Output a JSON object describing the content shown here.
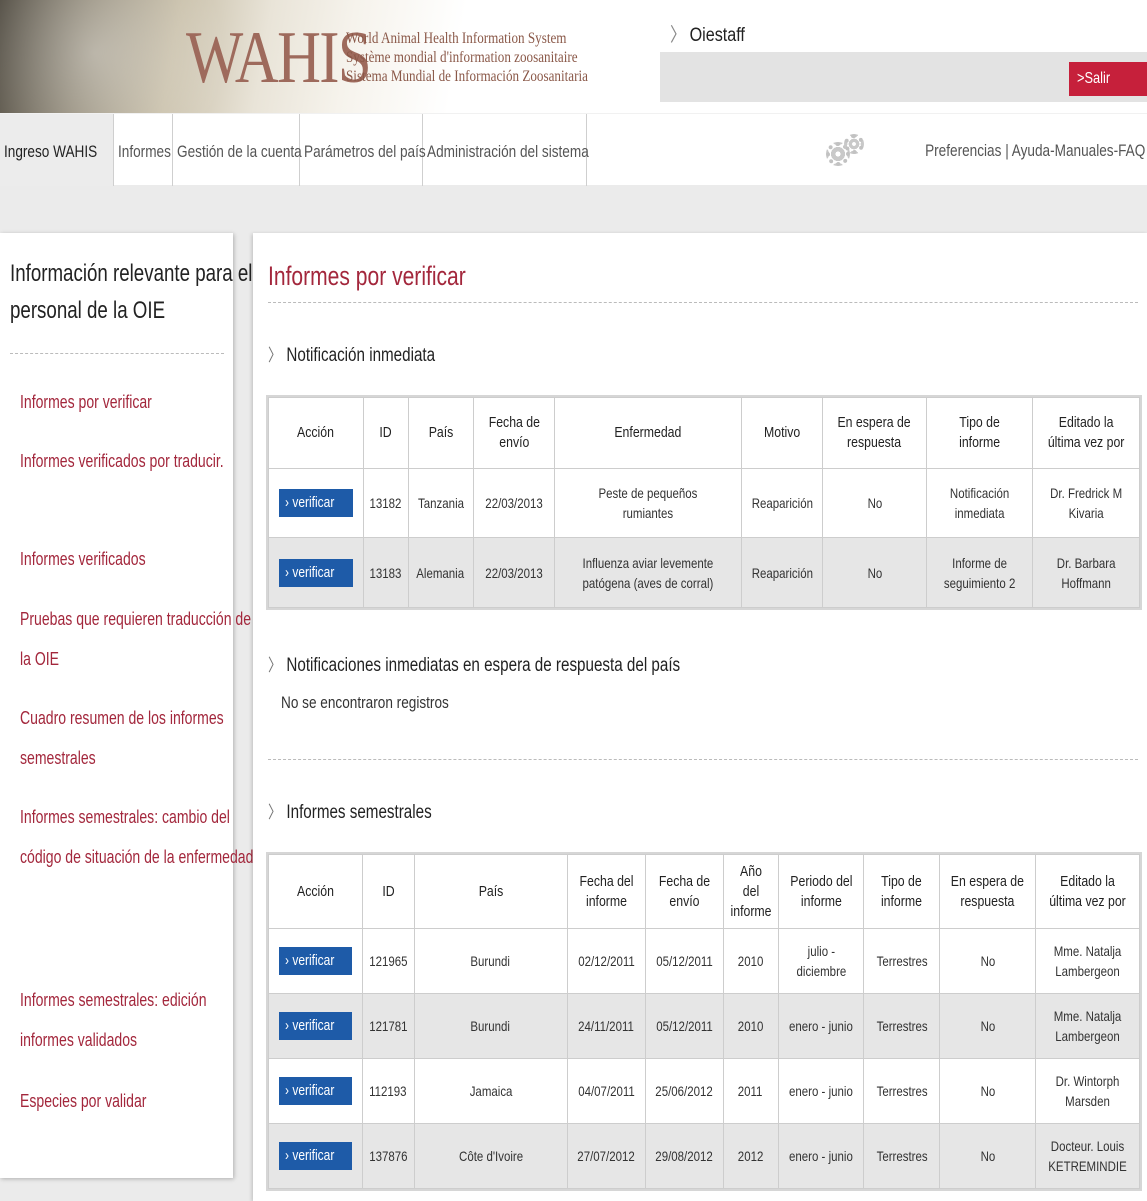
{
  "header": {
    "logo": "WAHIS",
    "tagline_en": "World Animal Health Information System",
    "tagline_fr": "Système mondial d'information zoosanitaire",
    "tagline_es": "Sistema Mundial de Información Zoosanitaria",
    "user": "Oiestaff",
    "logout_label": ">Salir"
  },
  "nav": {
    "tabs": [
      {
        "label": "Ingreso WAHIS"
      },
      {
        "label": "Informes"
      },
      {
        "label": "Gestión de la cuenta"
      },
      {
        "label": "Parámetros del país"
      },
      {
        "label": "Administración del sistema"
      }
    ],
    "right_links": {
      "preferences": "Preferencias",
      "separator": "|",
      "help": "Ayuda-Manuales-FAQ"
    }
  },
  "sidebar": {
    "title": "Información relevante para el personal de la OIE",
    "items": [
      {
        "label": "Informes por verificar"
      },
      {
        "label": "Informes verificados por traducir."
      },
      {
        "label": "Informes verificados"
      },
      {
        "label": "Pruebas que requieren traducción de la OIE"
      },
      {
        "label": "Cuadro resumen de los informes semestrales"
      },
      {
        "label": "Informes semestrales: cambio del código de situación de la enfermedad"
      },
      {
        "label": "Informes semestrales: edición informes validados"
      },
      {
        "label": "Especies por validar"
      }
    ]
  },
  "main": {
    "title": "Informes por verificar",
    "section1": {
      "title": "Notificación inmediata",
      "headers": [
        "Acción",
        "ID",
        "País",
        "Fecha de envío",
        "Enfermedad",
        "Motivo",
        "En espera de respuesta",
        "Tipo de informe",
        "Editado la última vez por"
      ],
      "rows": [
        {
          "action": "verificar",
          "id": "13182",
          "country": "Tanzania",
          "date": "22/03/2013",
          "disease": "Peste de pequeños rumiantes",
          "reason": "Reaparición",
          "waiting": "No",
          "type": "Notificación inmediata",
          "editor": "Dr. Fredrick M Kivaria"
        },
        {
          "action": "verificar",
          "id": "13183",
          "country": "Alemania",
          "date": "22/03/2013",
          "disease": "Influenza aviar levemente patógena (aves de corral)",
          "reason": "Reaparición",
          "waiting": "No",
          "type": "Informe de seguimiento 2",
          "editor": "Dr. Barbara Hoffmann"
        }
      ]
    },
    "section2": {
      "title": "Notificaciones inmediatas en espera de respuesta del país",
      "empty": "No se encontraron registros"
    },
    "section3": {
      "title": "Informes semestrales",
      "headers": [
        "Acción",
        "ID",
        "País",
        "Fecha del informe",
        "Fecha de envío",
        "Año del informe",
        "Periodo del informe",
        "Tipo de informe",
        "En espera de respuesta",
        "Editado la última vez por"
      ],
      "rows": [
        {
          "action": "verificar",
          "id": "121965",
          "country": "Burundi",
          "report_date": "02/12/2011",
          "sent_date": "05/12/2011",
          "year": "2010",
          "period": "julio - diciembre",
          "type": "Terrestres",
          "waiting": "No",
          "editor": "Mme. Natalja Lambergeon"
        },
        {
          "action": "verificar",
          "id": "121781",
          "country": "Burundi",
          "report_date": "24/11/2011",
          "sent_date": "05/12/2011",
          "year": "2010",
          "period": "enero - junio",
          "type": "Terrestres",
          "waiting": "No",
          "editor": "Mme. Natalja Lambergeon"
        },
        {
          "action": "verificar",
          "id": "112193",
          "country": "Jamaica",
          "report_date": "04/07/2011",
          "sent_date": "25/06/2012",
          "year": "2011",
          "period": "enero - junio",
          "type": "Terrestres",
          "waiting": "No",
          "editor": "Dr. Wintorph Marsden"
        },
        {
          "action": "verificar",
          "id": "137876",
          "country": "Côte d'Ivoire",
          "report_date": "27/07/2012",
          "sent_date": "29/08/2012",
          "year": "2012",
          "period": "enero - junio",
          "type": "Terrestres",
          "waiting": "No",
          "editor": "Docteur. Louis KETREMINDIE"
        }
      ]
    }
  }
}
